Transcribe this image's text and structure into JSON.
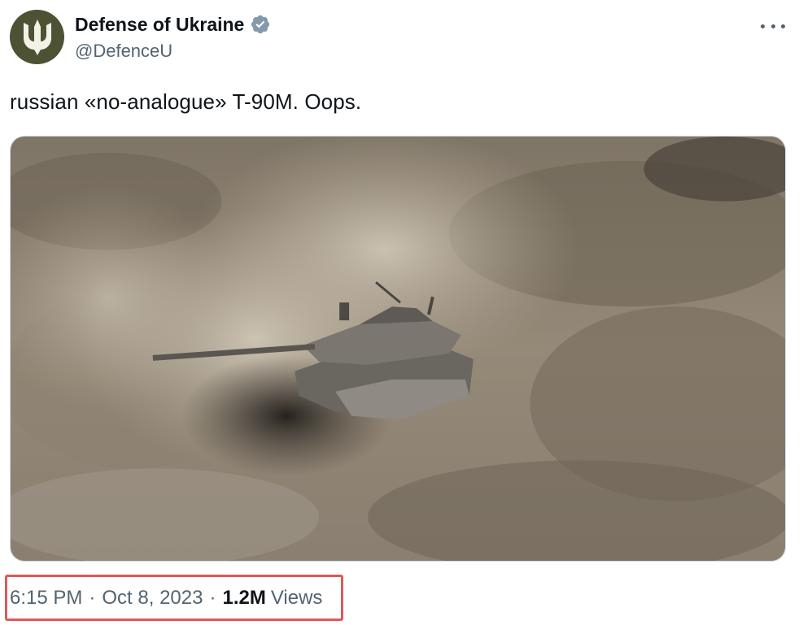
{
  "tweet": {
    "author": {
      "display_name": "Defense of Ukraine",
      "handle": "@DefenceU",
      "verified": true,
      "avatar_icon": "ukraine-trident-icon",
      "avatar_color": "#4d5234"
    },
    "text": "russian «no-analogue» T-90M. Oops.",
    "media": {
      "type": "video-still"
    },
    "time": "6:15 PM",
    "separator": "·",
    "date": "Oct 8, 2023",
    "views_count": "1.2M",
    "views_label": "Views",
    "highlight_color": "#e05858"
  },
  "icons": {
    "verified": "verified-badge-icon",
    "more": "more-options-icon"
  }
}
